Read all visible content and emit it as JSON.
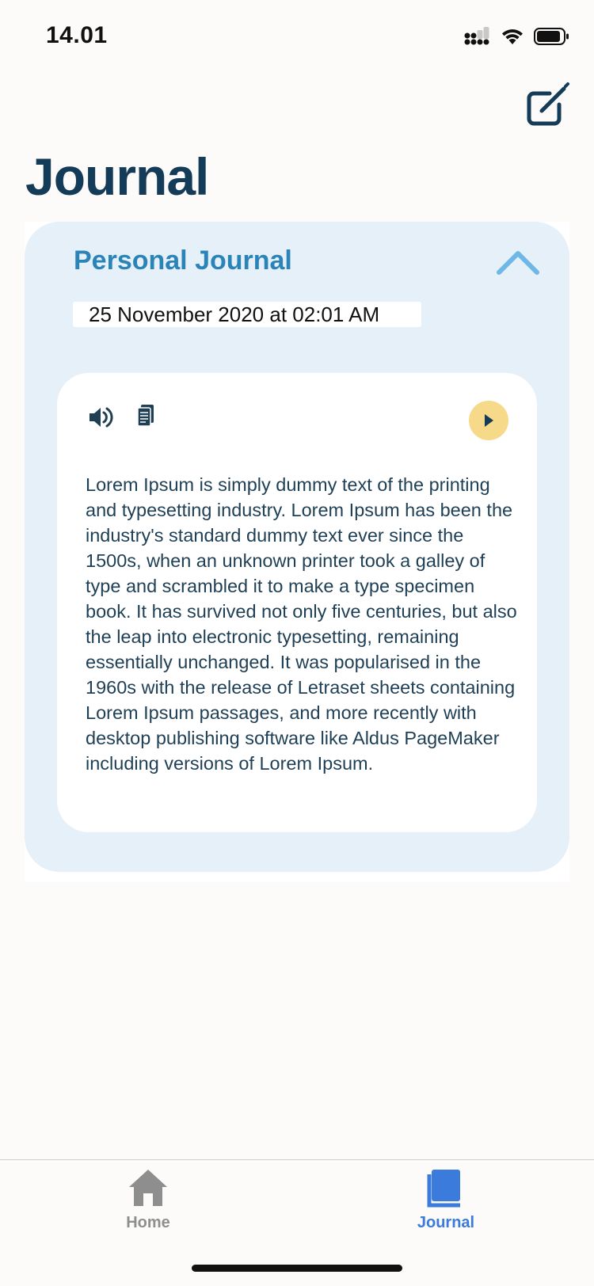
{
  "status_bar": {
    "time": "14.01"
  },
  "header": {
    "title": "Journal",
    "compose_icon": "compose-icon"
  },
  "journal": {
    "title": "Personal Journal",
    "date": "25 November 2020 at 02:01 AM",
    "collapse_icon": "chevron-up-icon",
    "entry": {
      "speaker_icon": "speaker-icon",
      "document_icon": "document-icon",
      "play_icon": "play-icon",
      "text": "Lorem Ipsum is simply dummy text of the printing and typesetting industry. Lorem Ipsum has been the industry's standard dummy text ever since the 1500s, when an unknown printer took a galley of type and scrambled it to make a type specimen book. It has survived not only five centuries, but also the leap into electronic typesetting, remaining essentially unchanged. It was popularised in the 1960s with the release of Letraset sheets containing Lorem Ipsum passages, and more recently with desktop publishing software like Aldus PageMaker including versions of Lorem Ipsum."
    }
  },
  "tab_bar": {
    "tabs": [
      {
        "label": "Home",
        "icon": "home-icon",
        "active": false
      },
      {
        "label": "Journal",
        "icon": "book-icon",
        "active": true
      }
    ]
  },
  "colors": {
    "title": "#143b57",
    "card_background": "#e6f0f8",
    "card_title": "#2a84b8",
    "play_button": "#f7d98a",
    "active_tab": "#3b7bdc",
    "inactive_tab": "#8e8e8e"
  }
}
